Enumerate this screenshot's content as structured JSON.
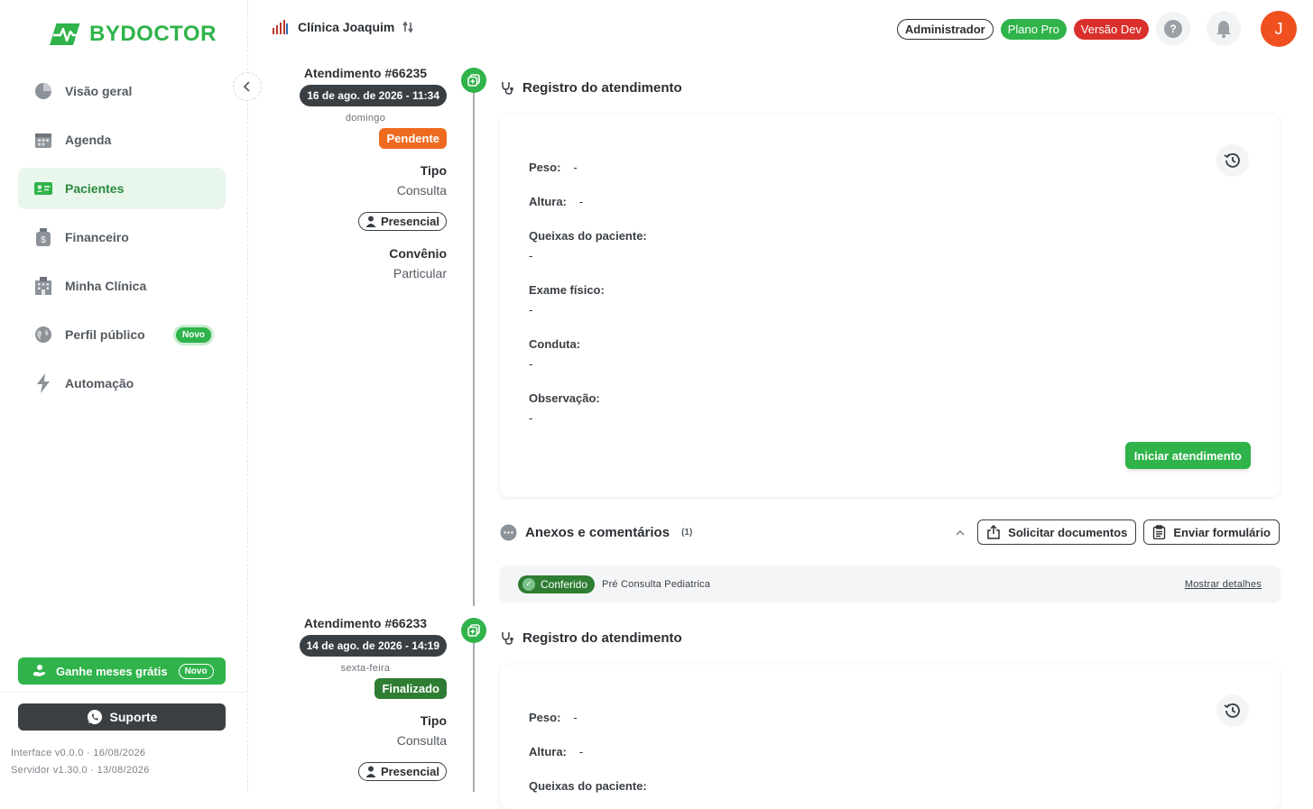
{
  "brand": {
    "name": "BYDOCTOR",
    "color": "#2fb34a"
  },
  "sidebar": {
    "items": [
      {
        "label": "Visão geral",
        "icon": "pie-chart-icon",
        "active": false
      },
      {
        "label": "Agenda",
        "icon": "calendar-icon",
        "active": false
      },
      {
        "label": "Pacientes",
        "icon": "patient-card-icon",
        "active": true
      },
      {
        "label": "Financeiro",
        "icon": "money-bag-icon",
        "active": false
      },
      {
        "label": "Minha Clínica",
        "icon": "building-icon",
        "active": false
      },
      {
        "label": "Perfil público",
        "icon": "globe-icon",
        "active": false,
        "badge": "Novo"
      },
      {
        "label": "Automação",
        "icon": "lightning-icon",
        "active": false
      }
    ],
    "promo": {
      "label": "Ganhe meses grátis",
      "badge": "Novo"
    },
    "support": {
      "label": "Suporte"
    },
    "version_interface": "Interface v0.0.0 · 16/08/2026",
    "version_server": "Servidor v1.30.0 · 13/08/2026"
  },
  "header": {
    "clinic_name": "Clínica Joaquim",
    "role": "Administrador",
    "plan": "Plano Pro",
    "env": "Versão Dev",
    "help": "?",
    "avatar_initial": "J"
  },
  "appointments": [
    {
      "title": "Atendimento #66235",
      "date": "16 de ago. de 2026 - 11:34",
      "weekday": "domingo",
      "status": "Pendente",
      "type_label": "Tipo",
      "type_value": "Consulta",
      "mode": "Presencial",
      "insurance_label": "Convênio",
      "insurance_value": "Particular",
      "record": {
        "section_title": "Registro do atendimento",
        "weight_label": "Peso:",
        "weight_value": "-",
        "height_label": "Altura:",
        "height_value": "-",
        "complaints_label": "Queixas do paciente:",
        "complaints_value": "-",
        "exam_label": "Exame físico:",
        "exam_value": "-",
        "conduct_label": "Conduta:",
        "conduct_value": "-",
        "notes_label": "Observação:",
        "notes_value": "-",
        "start_button": "Iniciar atendimento"
      },
      "attachments": {
        "title": "Anexos e comentários",
        "count": "(1)",
        "request_docs": "Solicitar documentos",
        "send_form": "Enviar formulário",
        "items": [
          {
            "status": "Conferido",
            "name": "Pré Consulta Pediatrica",
            "link": "Mostrar detalhes"
          }
        ]
      }
    },
    {
      "title": "Atendimento #66233",
      "date": "14 de ago. de 2026 - 14:19",
      "weekday": "sexta-feira",
      "status": "Finalizado",
      "type_label": "Tipo",
      "type_value": "Consulta",
      "mode": "Presencial",
      "record": {
        "section_title": "Registro do atendimento",
        "weight_label": "Peso:",
        "weight_value": "-",
        "height_label": "Altura:",
        "height_value": "-",
        "complaints_label": "Queixas do paciente:"
      }
    }
  ]
}
